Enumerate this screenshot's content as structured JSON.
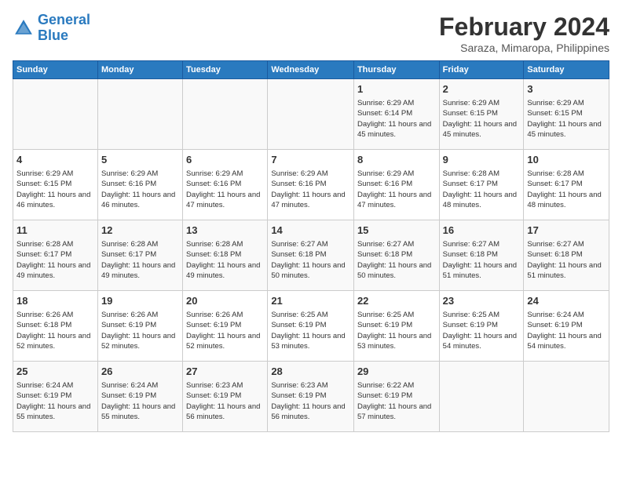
{
  "logo": {
    "text_general": "General",
    "text_blue": "Blue"
  },
  "title": "February 2024",
  "subtitle": "Saraza, Mimaropa, Philippines",
  "headers": [
    "Sunday",
    "Monday",
    "Tuesday",
    "Wednesday",
    "Thursday",
    "Friday",
    "Saturday"
  ],
  "weeks": [
    [
      {
        "num": "",
        "info": ""
      },
      {
        "num": "",
        "info": ""
      },
      {
        "num": "",
        "info": ""
      },
      {
        "num": "",
        "info": ""
      },
      {
        "num": "1",
        "info": "Sunrise: 6:29 AM\nSunset: 6:14 PM\nDaylight: 11 hours and 45 minutes."
      },
      {
        "num": "2",
        "info": "Sunrise: 6:29 AM\nSunset: 6:15 PM\nDaylight: 11 hours and 45 minutes."
      },
      {
        "num": "3",
        "info": "Sunrise: 6:29 AM\nSunset: 6:15 PM\nDaylight: 11 hours and 45 minutes."
      }
    ],
    [
      {
        "num": "4",
        "info": "Sunrise: 6:29 AM\nSunset: 6:15 PM\nDaylight: 11 hours and 46 minutes."
      },
      {
        "num": "5",
        "info": "Sunrise: 6:29 AM\nSunset: 6:16 PM\nDaylight: 11 hours and 46 minutes."
      },
      {
        "num": "6",
        "info": "Sunrise: 6:29 AM\nSunset: 6:16 PM\nDaylight: 11 hours and 47 minutes."
      },
      {
        "num": "7",
        "info": "Sunrise: 6:29 AM\nSunset: 6:16 PM\nDaylight: 11 hours and 47 minutes."
      },
      {
        "num": "8",
        "info": "Sunrise: 6:29 AM\nSunset: 6:16 PM\nDaylight: 11 hours and 47 minutes."
      },
      {
        "num": "9",
        "info": "Sunrise: 6:28 AM\nSunset: 6:17 PM\nDaylight: 11 hours and 48 minutes."
      },
      {
        "num": "10",
        "info": "Sunrise: 6:28 AM\nSunset: 6:17 PM\nDaylight: 11 hours and 48 minutes."
      }
    ],
    [
      {
        "num": "11",
        "info": "Sunrise: 6:28 AM\nSunset: 6:17 PM\nDaylight: 11 hours and 49 minutes."
      },
      {
        "num": "12",
        "info": "Sunrise: 6:28 AM\nSunset: 6:17 PM\nDaylight: 11 hours and 49 minutes."
      },
      {
        "num": "13",
        "info": "Sunrise: 6:28 AM\nSunset: 6:18 PM\nDaylight: 11 hours and 49 minutes."
      },
      {
        "num": "14",
        "info": "Sunrise: 6:27 AM\nSunset: 6:18 PM\nDaylight: 11 hours and 50 minutes."
      },
      {
        "num": "15",
        "info": "Sunrise: 6:27 AM\nSunset: 6:18 PM\nDaylight: 11 hours and 50 minutes."
      },
      {
        "num": "16",
        "info": "Sunrise: 6:27 AM\nSunset: 6:18 PM\nDaylight: 11 hours and 51 minutes."
      },
      {
        "num": "17",
        "info": "Sunrise: 6:27 AM\nSunset: 6:18 PM\nDaylight: 11 hours and 51 minutes."
      }
    ],
    [
      {
        "num": "18",
        "info": "Sunrise: 6:26 AM\nSunset: 6:18 PM\nDaylight: 11 hours and 52 minutes."
      },
      {
        "num": "19",
        "info": "Sunrise: 6:26 AM\nSunset: 6:19 PM\nDaylight: 11 hours and 52 minutes."
      },
      {
        "num": "20",
        "info": "Sunrise: 6:26 AM\nSunset: 6:19 PM\nDaylight: 11 hours and 52 minutes."
      },
      {
        "num": "21",
        "info": "Sunrise: 6:25 AM\nSunset: 6:19 PM\nDaylight: 11 hours and 53 minutes."
      },
      {
        "num": "22",
        "info": "Sunrise: 6:25 AM\nSunset: 6:19 PM\nDaylight: 11 hours and 53 minutes."
      },
      {
        "num": "23",
        "info": "Sunrise: 6:25 AM\nSunset: 6:19 PM\nDaylight: 11 hours and 54 minutes."
      },
      {
        "num": "24",
        "info": "Sunrise: 6:24 AM\nSunset: 6:19 PM\nDaylight: 11 hours and 54 minutes."
      }
    ],
    [
      {
        "num": "25",
        "info": "Sunrise: 6:24 AM\nSunset: 6:19 PM\nDaylight: 11 hours and 55 minutes."
      },
      {
        "num": "26",
        "info": "Sunrise: 6:24 AM\nSunset: 6:19 PM\nDaylight: 11 hours and 55 minutes."
      },
      {
        "num": "27",
        "info": "Sunrise: 6:23 AM\nSunset: 6:19 PM\nDaylight: 11 hours and 56 minutes."
      },
      {
        "num": "28",
        "info": "Sunrise: 6:23 AM\nSunset: 6:19 PM\nDaylight: 11 hours and 56 minutes."
      },
      {
        "num": "29",
        "info": "Sunrise: 6:22 AM\nSunset: 6:19 PM\nDaylight: 11 hours and 57 minutes."
      },
      {
        "num": "",
        "info": ""
      },
      {
        "num": "",
        "info": ""
      }
    ]
  ]
}
